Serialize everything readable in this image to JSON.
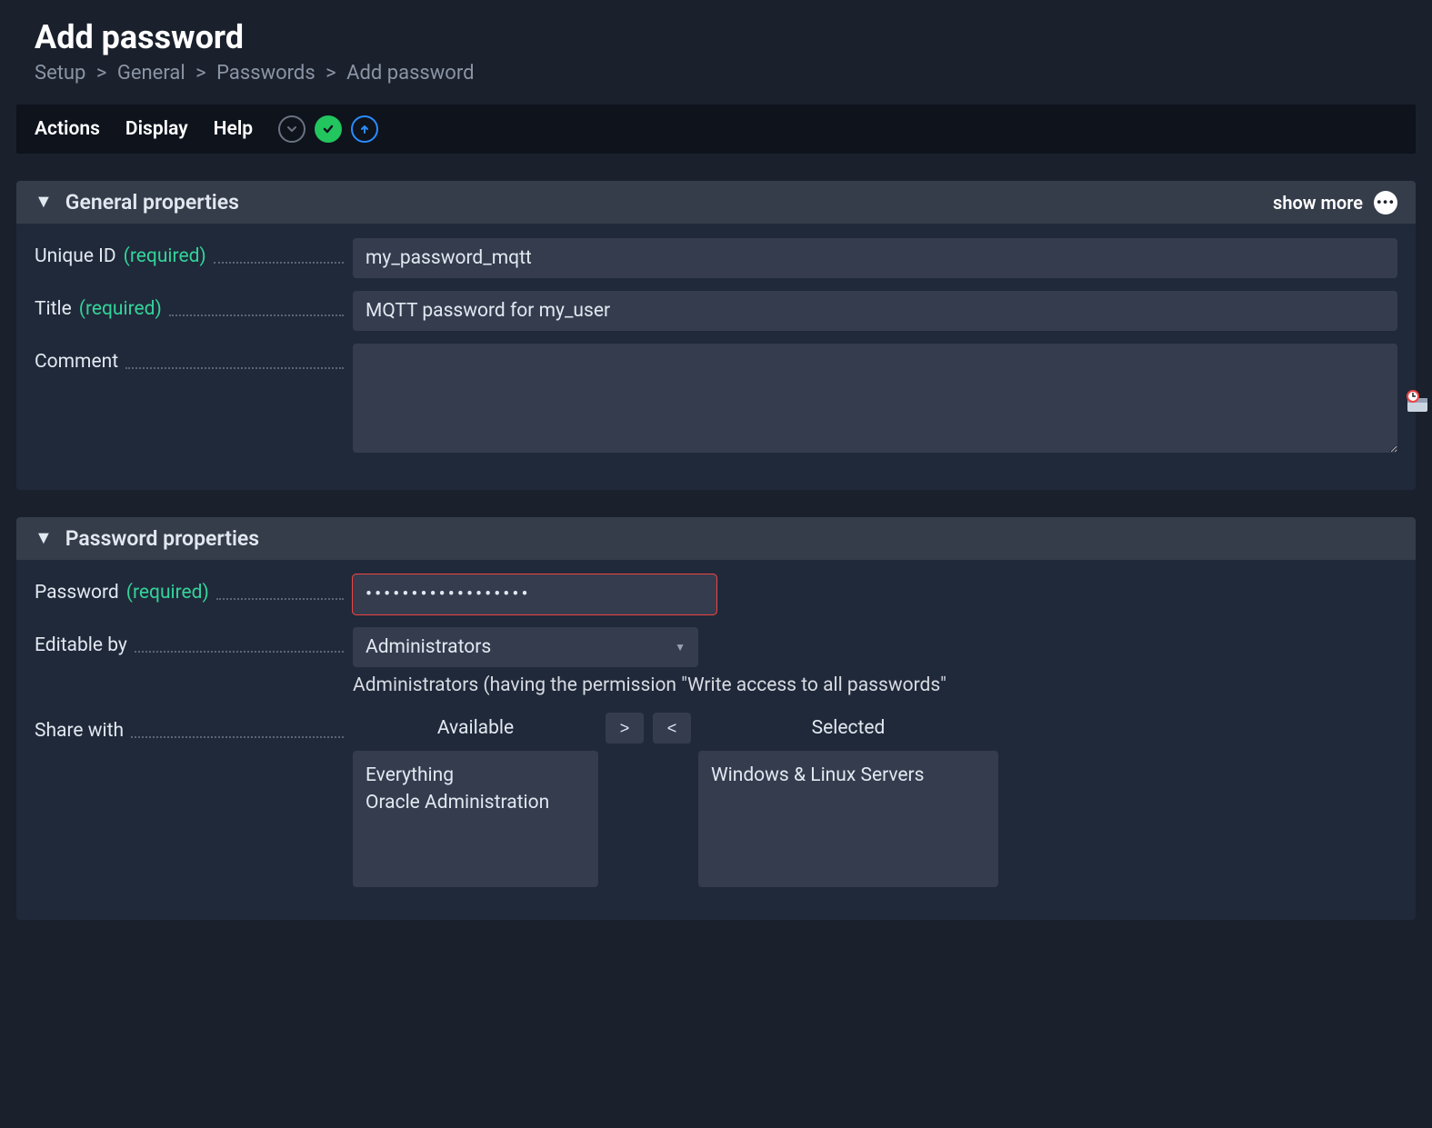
{
  "page": {
    "title": "Add password",
    "breadcrumb": [
      "Setup",
      "General",
      "Passwords",
      "Add password"
    ]
  },
  "toolbar": {
    "menus": {
      "actions": "Actions",
      "display": "Display",
      "help": "Help"
    }
  },
  "sections": {
    "general": {
      "title": "General properties",
      "show_more": "show more",
      "fields": {
        "unique_id": {
          "label": "Unique ID",
          "required": "(required)",
          "value": "my_password_mqtt"
        },
        "title_f": {
          "label": "Title",
          "required": "(required)",
          "value": "MQTT password for my_user"
        },
        "comment": {
          "label": "Comment",
          "value": ""
        }
      }
    },
    "password": {
      "title": "Password properties",
      "fields": {
        "password": {
          "label": "Password",
          "required": "(required)",
          "value": "••••••••••••••••••"
        },
        "editable_by": {
          "label": "Editable by",
          "value": "Administrators",
          "hint": "Administrators (having the permission \"Write access to all passwords\""
        },
        "share_with": {
          "label": "Share with",
          "headers": {
            "available": "Available",
            "selected": "Selected"
          },
          "available": [
            "Everything",
            "Oracle Administration"
          ],
          "selected": [
            "Windows & Linux Servers"
          ],
          "move_right": ">",
          "move_left": "<"
        }
      }
    }
  }
}
